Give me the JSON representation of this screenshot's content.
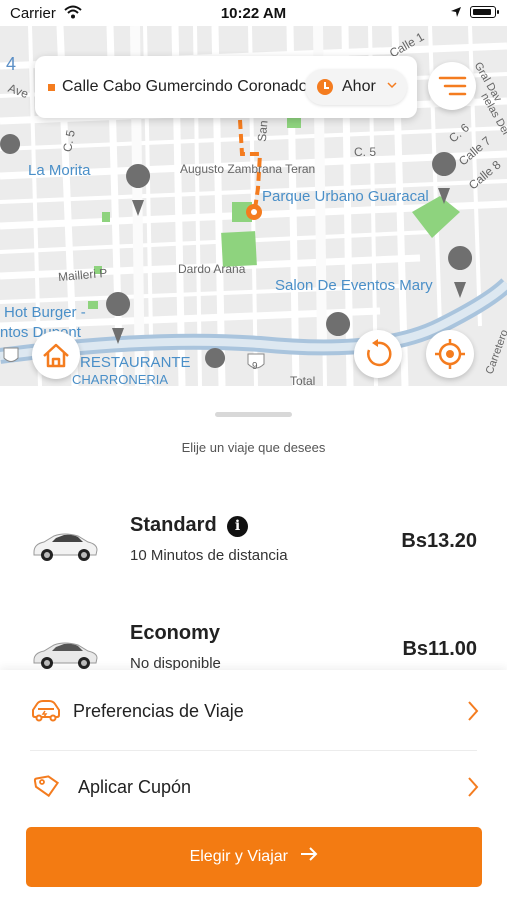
{
  "status_bar": {
    "carrier": "Carrier",
    "time": "10:22 AM"
  },
  "map": {
    "labels": {
      "la_morita": "La Morita",
      "augusto": "Augusto Zambrana Teran",
      "parque": "Parque Urbano Guaracal",
      "c5": "C. 5",
      "c5_left": "C. 5",
      "dardo": "Dardo Arana",
      "salon": "Salon De Eventos Mary",
      "hot_burger": "Hot Burger -",
      "ntos": "ntos Dupont",
      "restaurante": "RESTAURANTE",
      "charroneria": "CHARRONERIA",
      "mailleri": "Mailleri P",
      "ave": "Ave",
      "c6": "C. 6",
      "calle7": "Calle 7",
      "calle8": "Calle 8",
      "calle1": "Calle 1",
      "san": "San",
      "route9": "9",
      "total": "Total",
      "carretero": "Carretero",
      "num4": "4",
      "gral": "Gral Dav",
      "pelas": "nelas Del"
    }
  },
  "search": {
    "destination": "Calle Cabo Gumercindo Coronado",
    "time_label": "Ahor"
  },
  "sheet": {
    "title": "Elije un viaje que desees",
    "rides": [
      {
        "name": "Standard",
        "subtitle": "10 Minutos de distancia",
        "price": "Bs13.20"
      },
      {
        "name": "Economy",
        "subtitle": "No disponible",
        "price": "Bs11.00"
      }
    ]
  },
  "options": {
    "preferences": "Preferencias de Viaje",
    "coupon": "Aplicar Cupón",
    "cta": "Elegir y Viajar"
  },
  "colors": {
    "accent": "#f37b12",
    "map_bg": "#ececec",
    "park": "#8ed37e"
  },
  "icons": {
    "home": "home-icon",
    "history": "history-icon",
    "locate": "locate-icon",
    "menu": "menu-icon",
    "car_preference": "car-icon",
    "coupon": "tag-icon",
    "info": "info-icon"
  }
}
